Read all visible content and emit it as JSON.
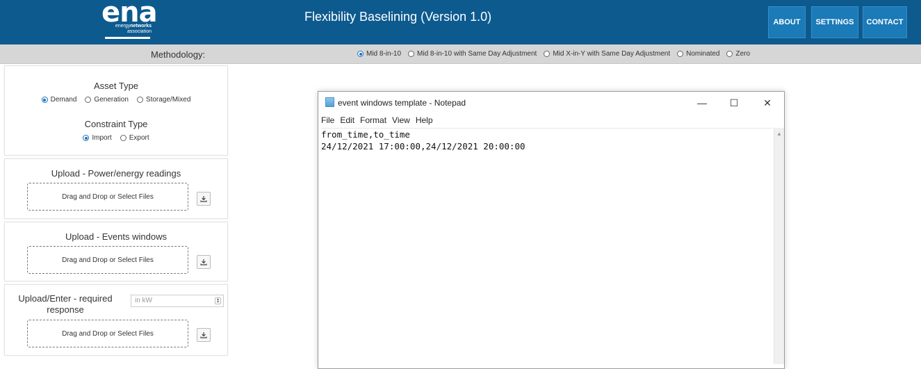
{
  "header": {
    "logo": {
      "mark": "ena",
      "line1_a": "energy",
      "line1_b": "networks",
      "line2": "association"
    },
    "title": "Flexibility Baselining (Version 1.0)",
    "nav": [
      "ABOUT",
      "SETTINGS",
      "CONTACT"
    ]
  },
  "methodology": {
    "label": "Methodology:",
    "options": [
      "Mid 8-in-10",
      "Mid 8-in-10 with Same Day Adjustment",
      "Mid X-in-Y with Same Day Adjustment",
      "Nominated",
      "Zero"
    ],
    "selected": "Mid 8-in-10"
  },
  "asset_panel": {
    "asset_type_title": "Asset Type",
    "asset_types": [
      "Demand",
      "Generation",
      "Storage/Mixed"
    ],
    "asset_selected": "Demand",
    "constraint_title": "Constraint Type",
    "constraint_types": [
      "Import",
      "Export"
    ],
    "constraint_selected": "Import"
  },
  "upload_power": {
    "title": "Upload - Power/energy readings",
    "dropzone": "Drag and Drop or Select Files"
  },
  "upload_events": {
    "title": "Upload - Events windows",
    "dropzone": "Drag and Drop or Select Files"
  },
  "upload_response": {
    "title_line1": "Upload/Enter - required",
    "title_line2": "response",
    "input_placeholder": "in kW",
    "dropzone": "Drag and Drop or Select Files"
  },
  "notepad": {
    "title": "event windows template - Notepad",
    "menu": [
      "File",
      "Edit",
      "Format",
      "View",
      "Help"
    ],
    "content": "from_time,to_time\n24/12/2021 17:00:00,24/12/2021 20:00:00",
    "controls": {
      "minimize": "—",
      "maximize": "☐",
      "close": "✕"
    }
  },
  "colors": {
    "header_bg": "#0d5a8f",
    "nav_btn": "#1b7ab8",
    "subbar_bg": "#d6d6d6",
    "radio_accent": "#1a6fc4"
  }
}
